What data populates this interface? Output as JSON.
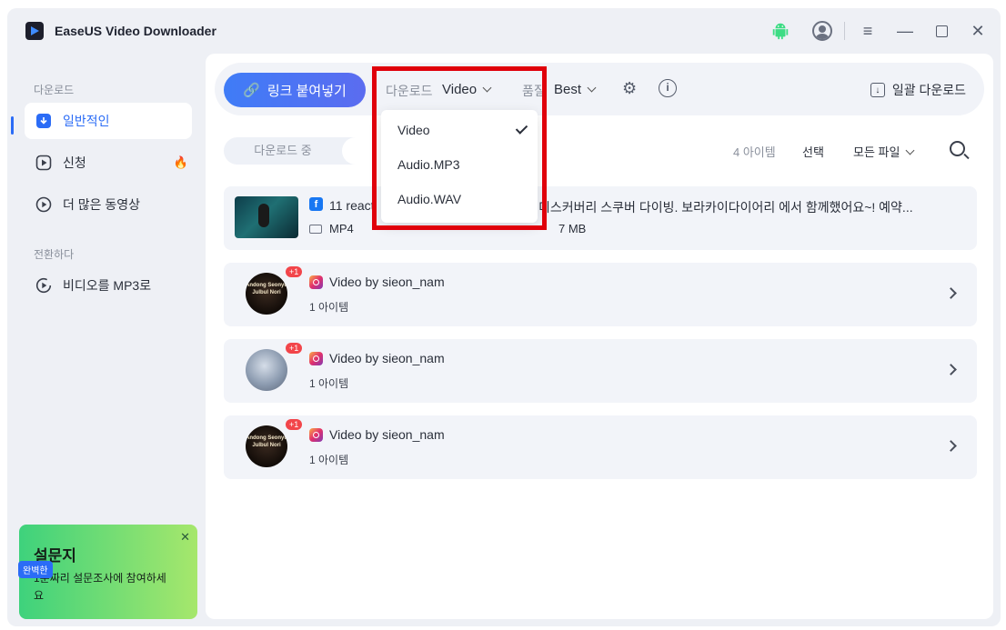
{
  "app": {
    "title": "EaseUS Video Downloader"
  },
  "sidebar": {
    "download_heading": "다운로드",
    "items": [
      {
        "label": "일반적인"
      },
      {
        "label": "신청"
      },
      {
        "label": "더 많은 동영상"
      }
    ],
    "convert_heading": "전환하다",
    "convert_items": [
      {
        "label": "비디오를 MP3로"
      }
    ],
    "survey": {
      "badge": "완벽한",
      "title": "설문지",
      "text": "1분짜리 설문조사에 참여하세요"
    }
  },
  "toolbar": {
    "paste_label": "링크 붙여넣기",
    "download_label": "다운로드",
    "download_value": "Video",
    "quality_label": "품질",
    "quality_value": "Best",
    "batch_label": "일괄 다운로드"
  },
  "dropdown": {
    "options": [
      "Video",
      "Audio.MP3",
      "Audio.WAV"
    ],
    "selected": "Video"
  },
  "list": {
    "tab_downloading": "다운로드 중",
    "tab_finished": "",
    "count": "4 아이템",
    "select_label": "선택",
    "filter_label": "모든 파일",
    "rows": [
      {
        "title_prefix": "11 react",
        "title_suffix": "디스커버리 스쿠버 다이빙. 보라카이다이어리 에서 함께했어요~! 예약...",
        "format": "MP4",
        "size": "7 MB"
      },
      {
        "badge": "+1",
        "title": "Video by sieon_nam",
        "sub": "1 아이템",
        "thumb_text": "Andong Seonyu Julbul Nori"
      },
      {
        "badge": "+1",
        "title": "Video by sieon_nam",
        "sub": "1 아이템"
      },
      {
        "badge": "+1",
        "title": "Video by sieon_nam",
        "sub": "1 아이템",
        "thumb_text": "Andong Seonyu Julbul Nori"
      }
    ]
  },
  "colors": {
    "accent": "#2b6cf6",
    "highlight": "#e0000b",
    "badge": "#f2454a"
  }
}
